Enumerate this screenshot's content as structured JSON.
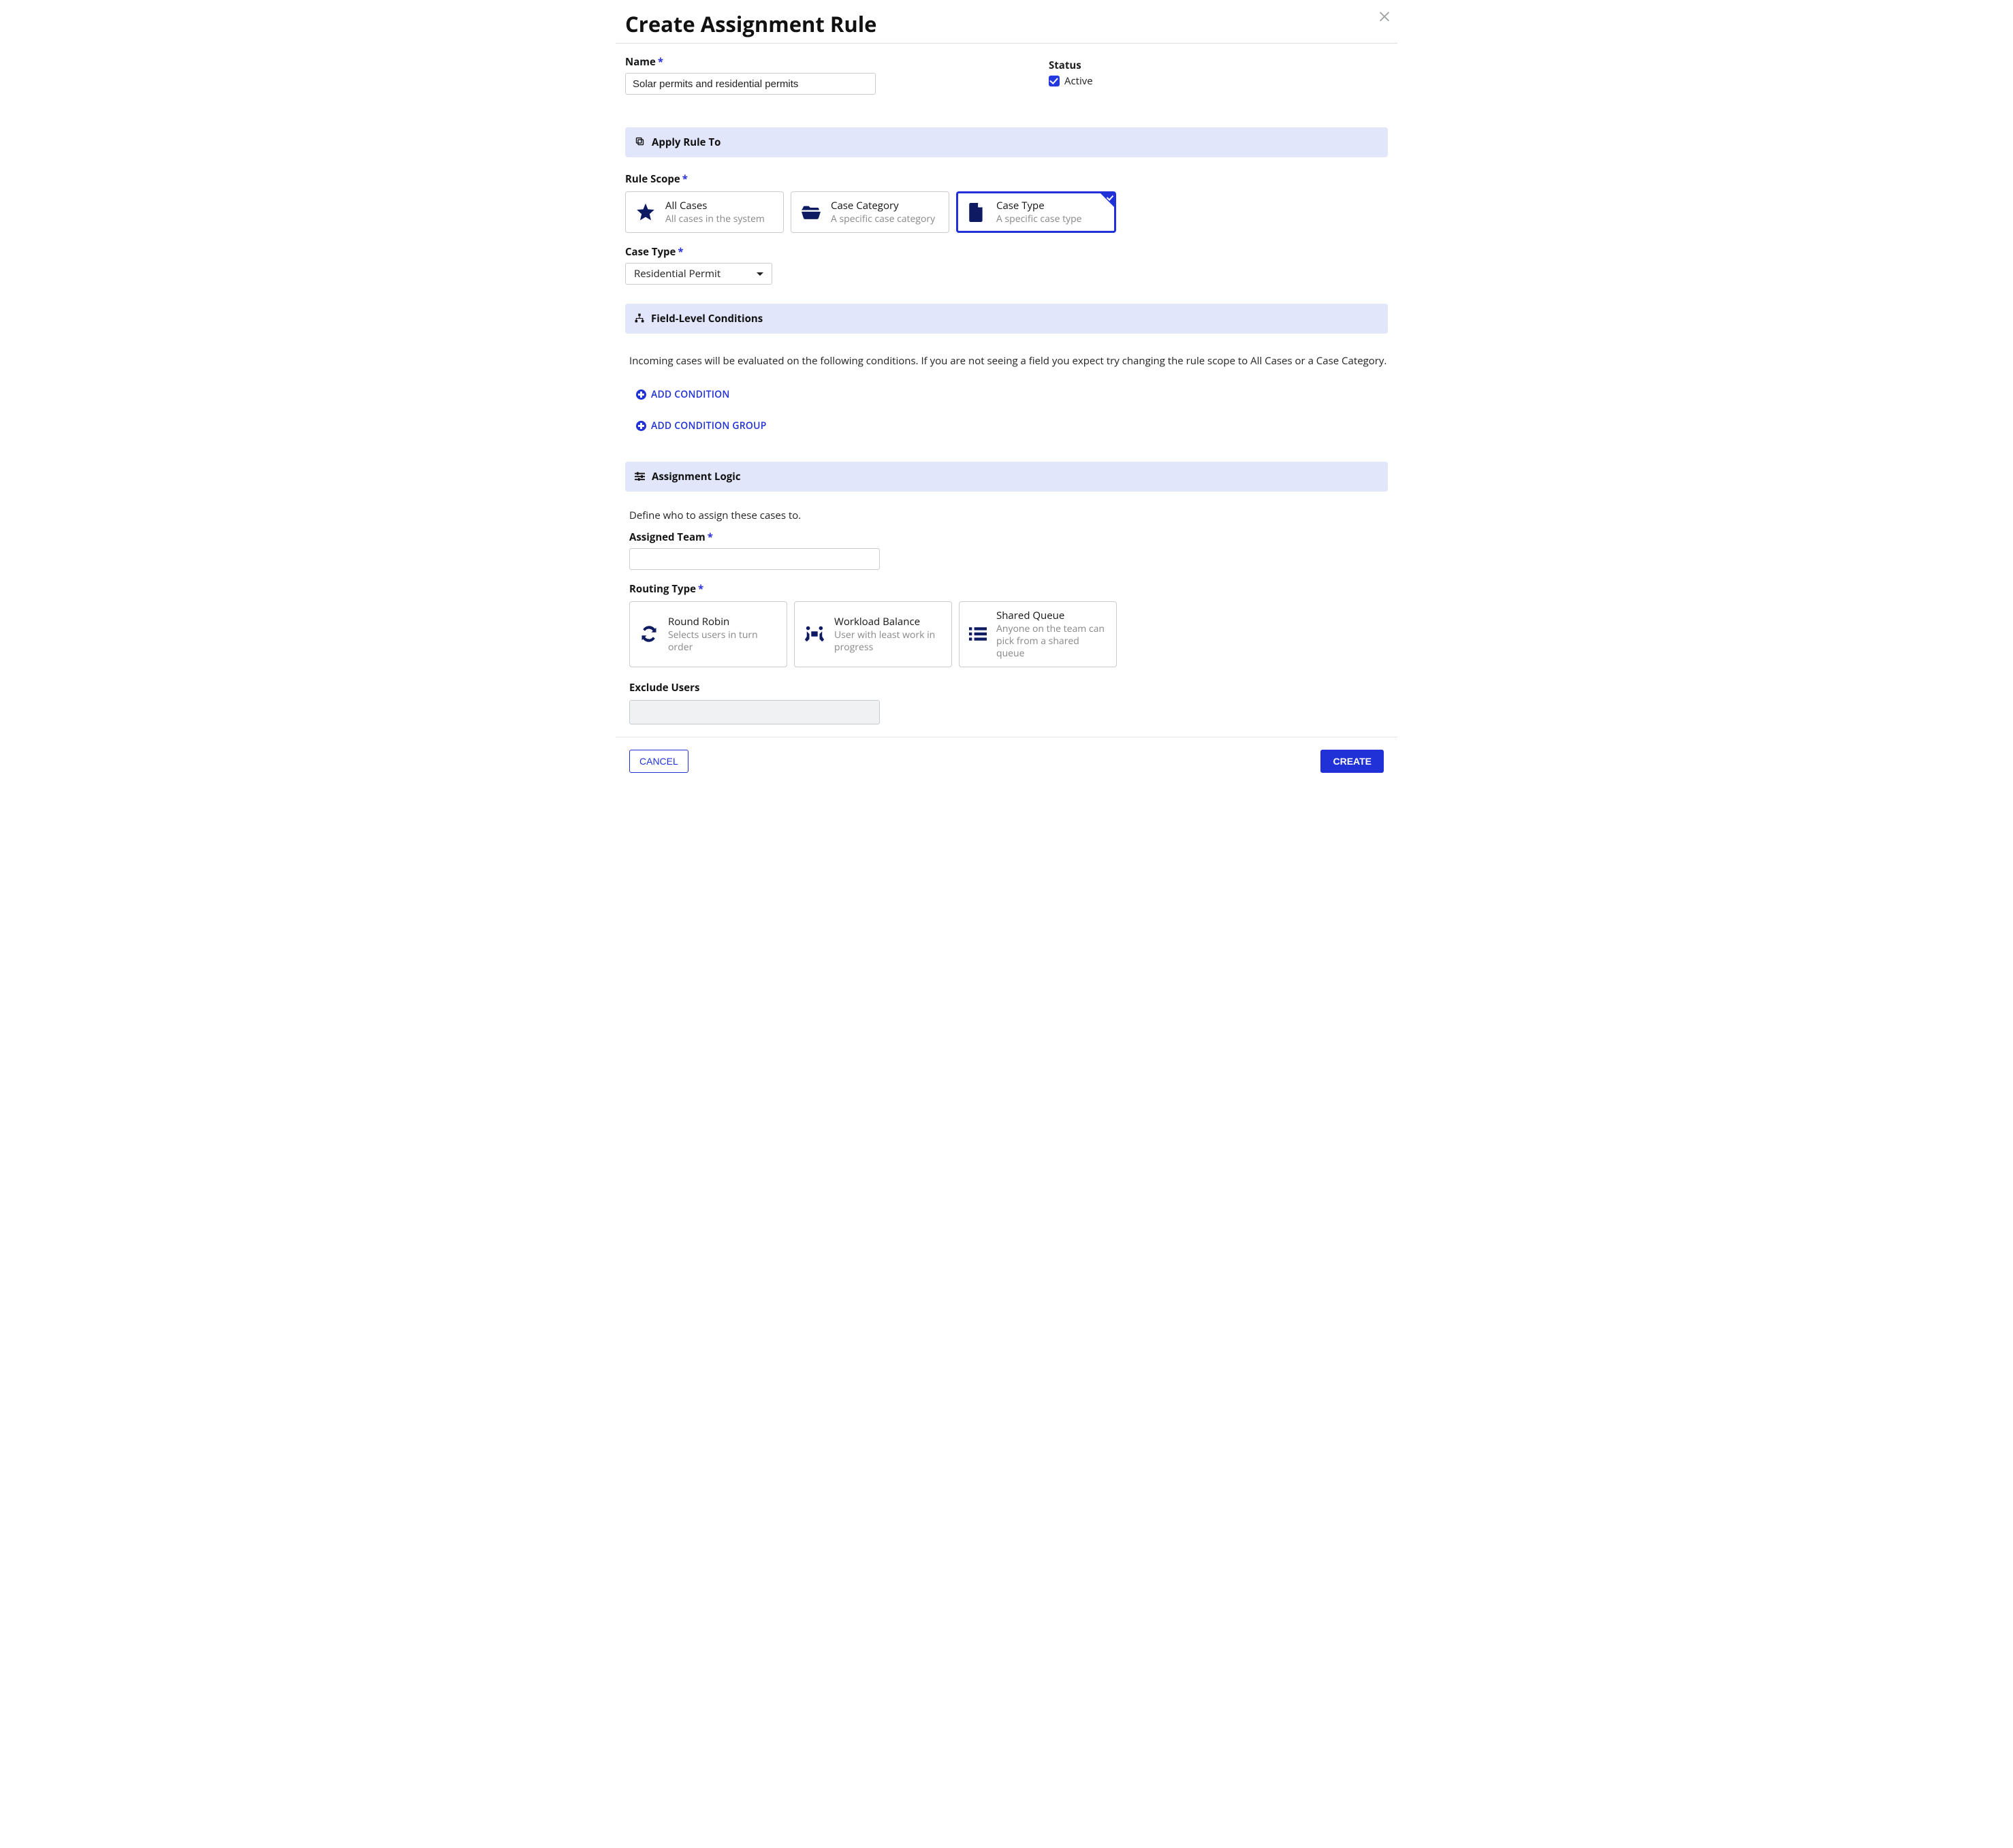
{
  "page": {
    "title": "Create Assignment Rule"
  },
  "name": {
    "label": "Name",
    "value": "Solar permits and residential permits"
  },
  "status": {
    "label": "Status",
    "option": "Active",
    "checked": true
  },
  "sections": {
    "apply_rule_to": "Apply Rule To",
    "field_conditions": "Field-Level Conditions",
    "assignment_logic": "Assignment Logic"
  },
  "rule_scope": {
    "label": "Rule Scope",
    "options": [
      {
        "title": "All Cases",
        "subtitle": "All cases in the system"
      },
      {
        "title": "Case Category",
        "subtitle": "A specific case category"
      },
      {
        "title": "Case Type",
        "subtitle": "A specific case type",
        "selected": true
      }
    ]
  },
  "case_type": {
    "label": "Case Type",
    "selected": "Residential Permit"
  },
  "conditions": {
    "helper": "Incoming cases will be evaluated on the following conditions. If you are not seeing a field you expect try changing the rule scope to All Cases or a Case Category.",
    "add_condition": "ADD CONDITION",
    "add_group": "ADD CONDITION GROUP"
  },
  "assignment": {
    "helper": "Define who to assign these cases to.",
    "assigned_team_label": "Assigned Team",
    "routing_type_label": "Routing Type",
    "exclude_users_label": "Exclude Users",
    "routing_options": [
      {
        "title": "Round Robin",
        "subtitle": "Selects users in turn order"
      },
      {
        "title": "Workload Balance",
        "subtitle": "User with least work in progress"
      },
      {
        "title": "Shared Queue",
        "subtitle": "Anyone on the team can pick from a shared queue"
      }
    ]
  },
  "footer": {
    "cancel": "CANCEL",
    "create": "CREATE"
  },
  "colors": {
    "primary": "#2031d7"
  }
}
